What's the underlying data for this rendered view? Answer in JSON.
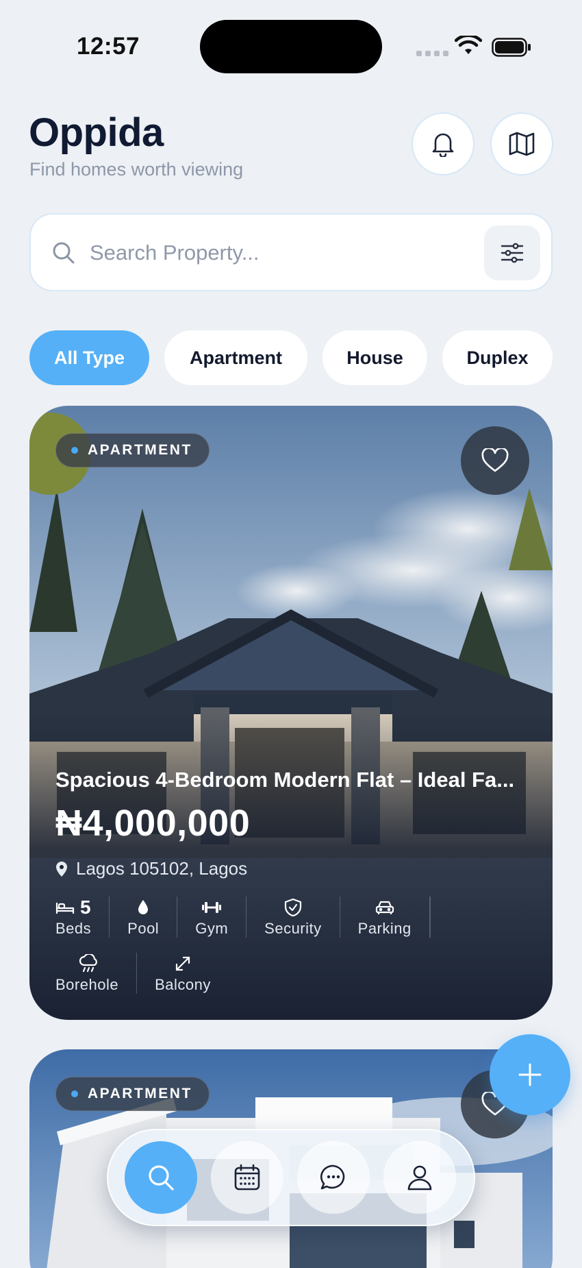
{
  "status_bar": {
    "time": "12:57"
  },
  "header": {
    "brand": "Oppida",
    "tagline": "Find homes worth viewing",
    "icons": {
      "bell": "bell-icon",
      "map": "map-icon"
    }
  },
  "search": {
    "placeholder": "Search Property...",
    "value": ""
  },
  "filters": {
    "chips": [
      "All Type",
      "Apartment",
      "House",
      "Duplex"
    ],
    "selected": "All Type"
  },
  "listings": [
    {
      "type_badge": "APARTMENT",
      "title": "Spacious 4-Bedroom Modern Flat – Ideal Fa...",
      "price": "₦4,000,000",
      "location": "Lagos 105102, Lagos",
      "beds": "5",
      "amenities": [
        "Beds",
        "Pool",
        "Gym",
        "Security",
        "Parking",
        "Borehole",
        "Balcony"
      ]
    },
    {
      "type_badge": "APARTMENT"
    }
  ],
  "colors": {
    "accent": "#55b0f7",
    "background": "#edf0f4",
    "text": "#131a2e"
  },
  "bottom_nav": {
    "items": [
      "search-icon",
      "calendar-icon",
      "chat-icon",
      "profile-icon"
    ],
    "active": "search-icon"
  }
}
